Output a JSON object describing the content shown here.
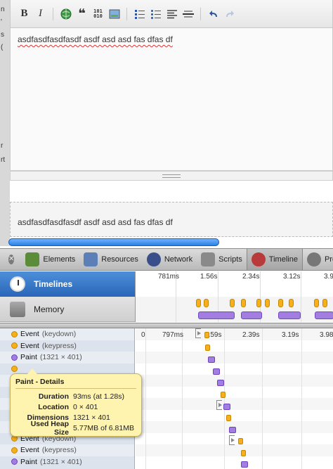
{
  "page_strip": {
    "chars": [
      "n",
      "'",
      "s",
      "(",
      "r",
      "rt"
    ]
  },
  "editor": {
    "toolbar": {
      "bold": "B",
      "italic": "I",
      "quote": "❝",
      "code": "101\n010"
    },
    "content": "asdfasdfasdfasdf asdf asd asd fas dfas df",
    "preview": "asdfasdfasdfasdf asdf asd asd fas dfas df"
  },
  "devtools": {
    "tabs": [
      {
        "label": "Elements",
        "icon": "elements-icon",
        "color": "#5b8c3a"
      },
      {
        "label": "Resources",
        "icon": "resources-icon",
        "color": "#5c7fb8"
      },
      {
        "label": "Network",
        "icon": "network-icon",
        "color": "#3a4f8a"
      },
      {
        "label": "Scripts",
        "icon": "scripts-icon",
        "color": "#8a8a8a"
      },
      {
        "label": "Timeline",
        "icon": "timeline-icon",
        "color": "#b83a3a"
      },
      {
        "label": "Pro",
        "icon": "profiles-icon",
        "color": "#777777"
      }
    ],
    "active_tab": "Timeline",
    "timeline": {
      "sections": {
        "timelines": "Timelines",
        "memory": "Memory"
      },
      "overview_ticks": [
        "781ms",
        "1.56s",
        "2.34s",
        "3.12s",
        "3.9"
      ],
      "detail_ticks": [
        "0",
        "797ms",
        "1.59s",
        "2.39s",
        "3.19s",
        "3.98"
      ],
      "records": [
        {
          "type": "event",
          "name": "Event",
          "detail": "(keydown)"
        },
        {
          "type": "event",
          "name": "Event",
          "detail": "(keypress)"
        },
        {
          "type": "paint",
          "name": "Paint",
          "detail": "(1321 × 401)"
        },
        {
          "type": "event",
          "name": "",
          "detail": ""
        },
        {
          "type": "event",
          "name": "",
          "detail": ""
        },
        {
          "type": "event",
          "name": "",
          "detail": ""
        },
        {
          "type": "event",
          "name": "",
          "detail": ""
        },
        {
          "type": "event",
          "name": "",
          "detail": ""
        },
        {
          "type": "event",
          "name": "",
          "detail": ""
        },
        {
          "type": "event",
          "name": "Event",
          "detail": "(keydown)"
        },
        {
          "type": "event",
          "name": "Event",
          "detail": "(keypress)"
        },
        {
          "type": "paint",
          "name": "Paint",
          "detail": "(1321 × 401)"
        }
      ],
      "popover": {
        "title": "Paint - Details",
        "rows": [
          {
            "k": "Duration",
            "v": "93ms (at 1.28s)"
          },
          {
            "k": "Location",
            "v": "0 × 401"
          },
          {
            "k": "Dimensions",
            "v": "1321 × 401"
          },
          {
            "k": "Used Heap Size",
            "v": "5.77MB of 6.81MB"
          }
        ]
      }
    }
  },
  "colors": {
    "event": "#f5b01a",
    "paint": "#a27ee0",
    "accent": "#2a66b8"
  }
}
